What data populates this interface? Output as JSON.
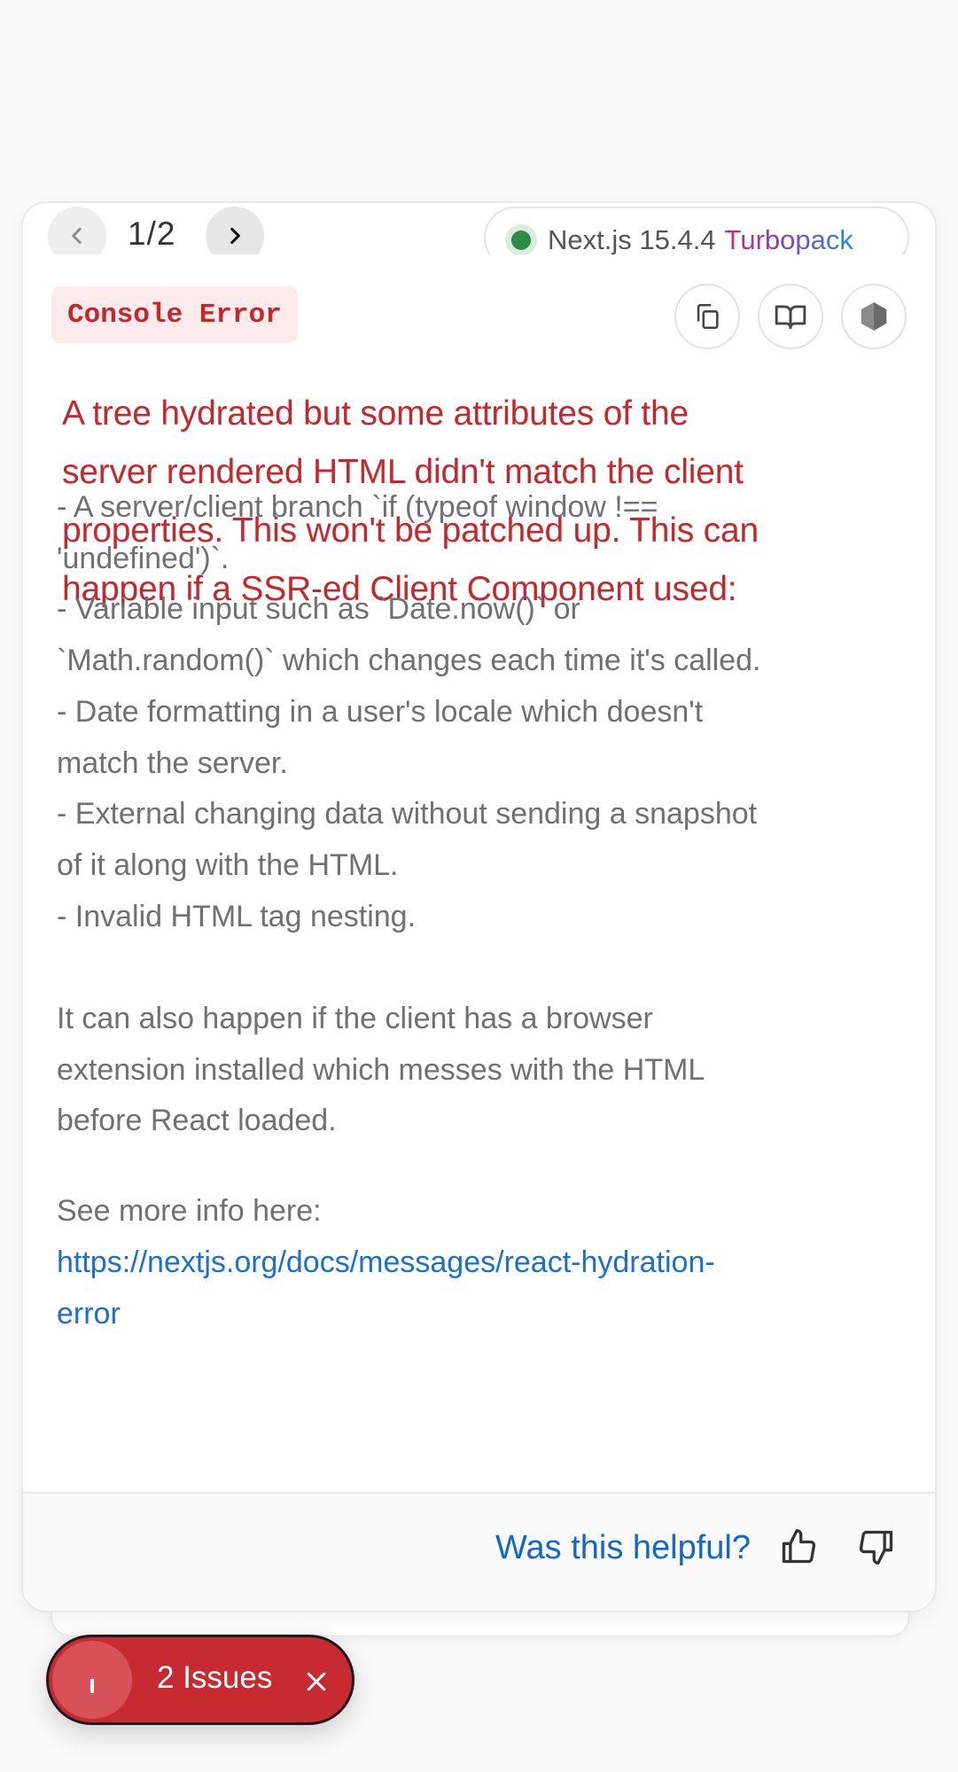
{
  "nav": {
    "pager_current": "1",
    "pager_total": "2",
    "pager_label": "1/2"
  },
  "version": {
    "framework": "Next.js 15.4.4",
    "bundler": "Turbopack"
  },
  "header": {
    "badge_label": "Console Error"
  },
  "error": {
    "title_lines": [
      "A tree hydrated but some attributes of the",
      "server rendered HTML didn't match the client",
      "properties. This won't be patched up. This can",
      "happen if a SSR-ed Client Component used:"
    ],
    "body_lines": [
      "- A server/client branch `if (typeof window !==",
      "'undefined')`.",
      "- Variable input such as `Date.now()` or",
      "`Math.random()` which changes each time it's called.",
      "- Date formatting in a user's locale which doesn't",
      "match the server.",
      "- External changing data without sending a snapshot",
      "of it along with the HTML.",
      "- Invalid HTML tag nesting."
    ],
    "extension_lines": [
      "It can also happen if the client has a browser",
      "extension installed which messes with the HTML",
      "before React loaded."
    ],
    "more_info_label": "See more info here:",
    "link_lines": [
      "https://nextjs.org/docs/messages/react-hydration-",
      "error"
    ]
  },
  "footer": {
    "helpful_label": "Was this helpful?"
  },
  "issues": {
    "label": "2 Issues",
    "count": 2
  },
  "icons": {
    "prev": "chevron-left-icon",
    "next": "chevron-right-icon",
    "copy": "copy-icon",
    "docs": "book-open-icon",
    "node": "nodejs-hexagon-icon",
    "thumbs_up": "thumbs-up-icon",
    "thumbs_down": "thumbs-down-icon",
    "close": "close-icon"
  },
  "colors": {
    "error_red": "#c8262c",
    "link_blue": "#1a6fd1",
    "badge_bg": "#fdeaea",
    "status_green": "#2e8b47"
  }
}
